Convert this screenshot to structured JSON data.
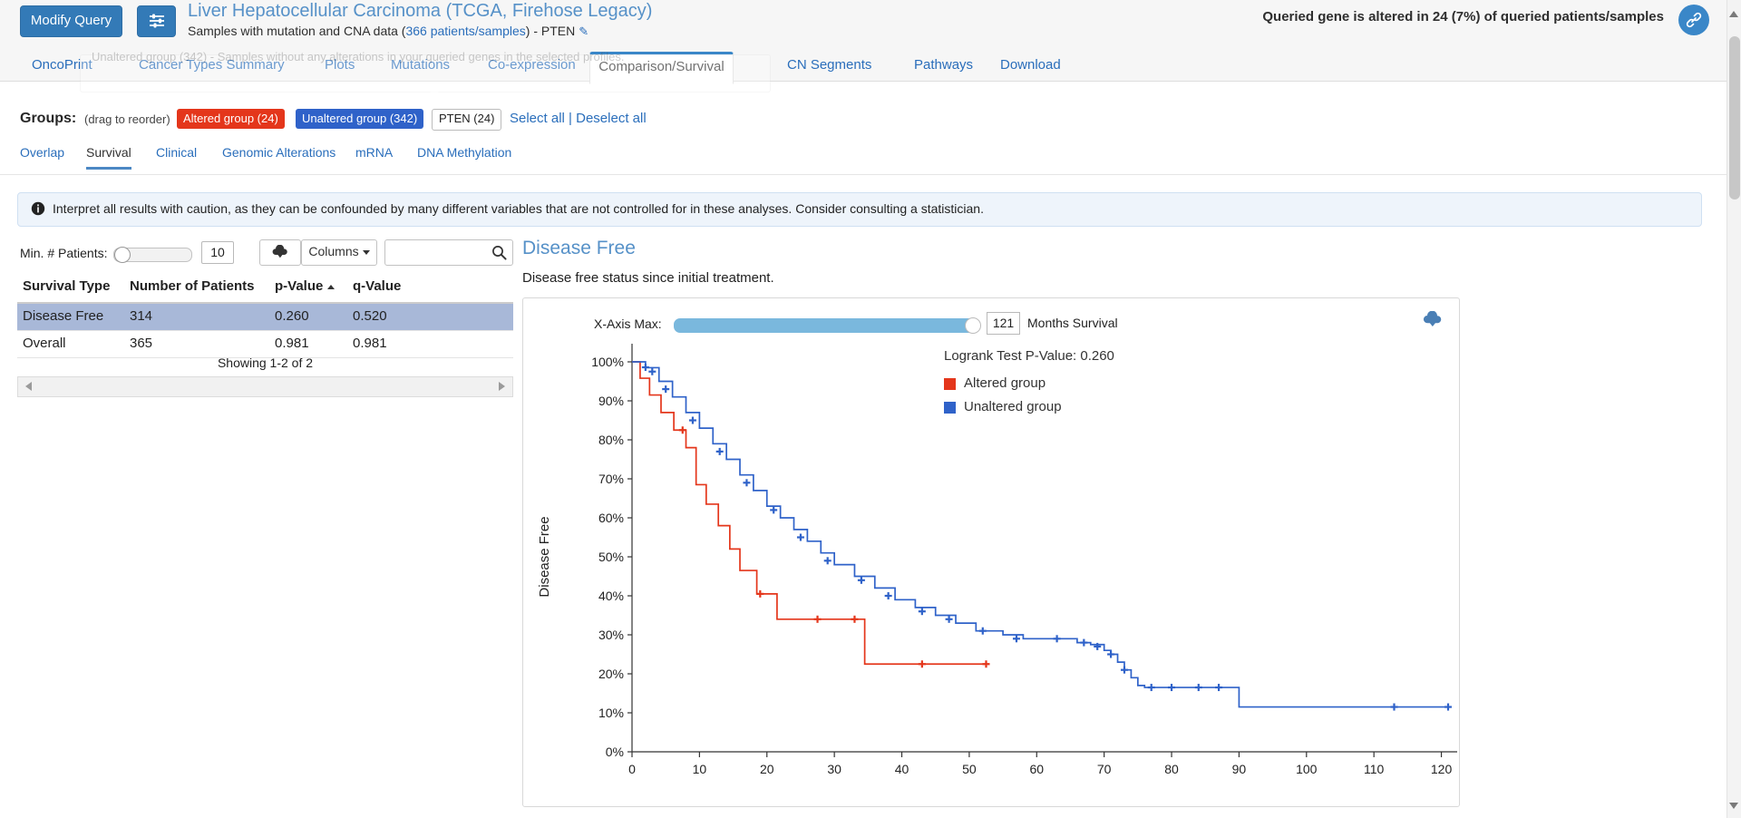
{
  "header": {
    "modify_query_label": "Modify Query",
    "settings_icon": "sliders-icon",
    "study_title": "Liver Hepatocellular Carcinoma (TCGA, Firehose Legacy)",
    "study_subtitle_prefix": "Samples with mutation and CNA data (",
    "study_sample_count": "366 patients/samples",
    "study_subtitle_suffix": ")  - PTEN",
    "edit_icon": "pencil-icon",
    "altered_note": "Queried gene is altered in 24 (7%) of queried patients/samples",
    "share_icon": "chain-link-icon"
  },
  "main_tabs": [
    {
      "label": "OncoPrint",
      "active": false
    },
    {
      "label": "Cancer Types Summary",
      "active": false
    },
    {
      "label": "Plots",
      "active": false
    },
    {
      "label": "Mutations",
      "active": false
    },
    {
      "label": "Co-expression",
      "active": false
    },
    {
      "label": "Comparison/Survival",
      "active": true
    },
    {
      "label": "CN Segments",
      "active": false
    },
    {
      "label": "Pathways",
      "active": false
    },
    {
      "label": "Download",
      "active": false
    }
  ],
  "tooltip_ghost": "Unaltered group (342) - Samples without any alterations in your queried genes in the selected profiles.",
  "groups": {
    "label": "Groups:",
    "hint": "(drag to reorder)",
    "pills": [
      {
        "label": "Altered group (24)",
        "style": "red"
      },
      {
        "label": "Unaltered group (342)",
        "style": "blue"
      },
      {
        "label": "PTEN (24)",
        "style": "plain"
      }
    ],
    "select_all": "Select all",
    "separator": "|",
    "deselect_all": "Deselect all"
  },
  "sub_tabs": [
    {
      "label": "Overlap",
      "active": false
    },
    {
      "label": "Survival",
      "active": true
    },
    {
      "label": "Clinical",
      "active": false
    },
    {
      "label": "Genomic Alterations",
      "active": false
    },
    {
      "label": "mRNA",
      "active": false
    },
    {
      "label": "DNA Methylation",
      "active": false
    }
  ],
  "banner": {
    "icon": "info-icon",
    "text": "Interpret all results with caution, as they can be confounded by many different variables that are not controlled for in these analyses. Consider consulting a statistician."
  },
  "toolbar": {
    "min_patients_label": "Min. # Patients:",
    "min_patients_value": "10",
    "download_icon": "cloud-download-icon",
    "columns_label": "Columns",
    "columns_caret": "chevron-down-icon",
    "search_placeholder": "",
    "search_value": "",
    "search_icon": "magnifier-icon"
  },
  "table": {
    "columns": [
      "Survival Type",
      "Number of Patients",
      "p-Value",
      "q-Value"
    ],
    "sorted_column": "p-Value",
    "sort_direction": "asc",
    "rows": [
      {
        "survival_type": "Disease Free",
        "patients": "314",
        "p_value": "0.260",
        "q_value": "0.520",
        "selected": true
      },
      {
        "survival_type": "Overall",
        "patients": "365",
        "p_value": "0.981",
        "q_value": "0.981",
        "selected": false
      }
    ],
    "showing": "Showing 1-2 of 2"
  },
  "panel": {
    "title": "Disease Free",
    "subtitle": "Disease free status since initial treatment.",
    "x_axis_max_label": "X-Axis Max:",
    "x_axis_max_value": "121",
    "x_axis_unit": "Months Survival",
    "chart_download_icon": "cloud-download-icon"
  },
  "chart_data": {
    "type": "line",
    "title": "Disease Free",
    "xlabel": "",
    "ylabel": "Disease Free",
    "xlim": [
      0,
      121
    ],
    "ylim": [
      0,
      100
    ],
    "grid": false,
    "legend_position": "right",
    "annotation": "Logrank Test P-Value: 0.260",
    "xticks": [
      0,
      10,
      20,
      30,
      40,
      50,
      60,
      70,
      80,
      90,
      100,
      110,
      120
    ],
    "yticks": [
      "0%",
      "10%",
      "20%",
      "30%",
      "40%",
      "50%",
      "60%",
      "70%",
      "80%",
      "90%",
      "100%"
    ],
    "colors": {
      "altered": "#e4361b",
      "unaltered": "#2f62c9"
    },
    "series": [
      {
        "name": "Altered group",
        "color": "#e4361b",
        "points": [
          [
            0,
            100
          ],
          [
            1.2,
            100
          ],
          [
            1.2,
            95.8
          ],
          [
            2.6,
            95.8
          ],
          [
            2.6,
            91.5
          ],
          [
            4.3,
            91.5
          ],
          [
            4.3,
            87.0
          ],
          [
            6.2,
            87.0
          ],
          [
            6.2,
            82.5
          ],
          [
            8.0,
            82.5
          ],
          [
            8.0,
            78.0
          ],
          [
            9.5,
            78.0
          ],
          [
            9.5,
            68.5
          ],
          [
            11.0,
            68.5
          ],
          [
            11.0,
            63.5
          ],
          [
            12.8,
            63.5
          ],
          [
            12.8,
            58.0
          ],
          [
            14.5,
            58.0
          ],
          [
            14.5,
            52.0
          ],
          [
            16.0,
            52.0
          ],
          [
            16.0,
            46.5
          ],
          [
            18.5,
            46.5
          ],
          [
            18.5,
            40.5
          ],
          [
            21.5,
            40.5
          ],
          [
            21.5,
            34.0
          ],
          [
            25.0,
            34.0
          ],
          [
            25.0,
            34.0
          ],
          [
            30.0,
            34.0
          ],
          [
            30.0,
            34.0
          ],
          [
            34.5,
            34.0
          ],
          [
            34.5,
            22.5
          ],
          [
            43.0,
            22.5
          ],
          [
            53.0,
            22.5
          ]
        ],
        "censor_marks": [
          [
            19.0,
            40.5
          ],
          [
            27.5,
            34.0
          ],
          [
            33.0,
            34.0
          ],
          [
            43.0,
            22.5
          ],
          [
            52.5,
            22.5
          ],
          [
            7.5,
            82.5
          ]
        ]
      },
      {
        "name": "Unaltered group",
        "color": "#2f62c9",
        "points": [
          [
            0,
            100
          ],
          [
            2,
            98.5
          ],
          [
            4,
            95
          ],
          [
            6,
            91
          ],
          [
            8,
            87
          ],
          [
            10,
            83
          ],
          [
            12,
            79
          ],
          [
            14,
            75
          ],
          [
            16,
            71
          ],
          [
            18,
            67
          ],
          [
            20,
            63
          ],
          [
            22,
            60
          ],
          [
            24,
            57
          ],
          [
            26,
            54
          ],
          [
            28,
            51
          ],
          [
            30,
            48
          ],
          [
            33,
            45
          ],
          [
            36,
            42
          ],
          [
            39,
            39
          ],
          [
            42,
            37
          ],
          [
            45,
            35
          ],
          [
            48,
            33
          ],
          [
            51,
            31
          ],
          [
            55,
            30
          ],
          [
            58,
            29
          ],
          [
            62,
            29
          ],
          [
            66,
            28
          ],
          [
            68,
            27.5
          ],
          [
            70,
            26
          ],
          [
            71,
            25
          ],
          [
            72,
            23
          ],
          [
            73,
            21
          ],
          [
            74,
            19
          ],
          [
            75,
            17
          ],
          [
            76,
            16.5
          ],
          [
            82,
            16.5
          ],
          [
            90,
            16.5
          ],
          [
            90,
            11.5
          ],
          [
            113,
            11.5
          ],
          [
            121,
            11.5
          ]
        ],
        "censor_marks": [
          [
            2,
            98.6
          ],
          [
            3,
            97.5
          ],
          [
            5,
            93
          ],
          [
            9,
            85
          ],
          [
            13,
            77
          ],
          [
            17,
            69
          ],
          [
            21,
            62
          ],
          [
            25,
            55
          ],
          [
            29,
            49
          ],
          [
            34,
            44
          ],
          [
            38,
            40
          ],
          [
            43,
            36
          ],
          [
            47,
            34
          ],
          [
            52,
            31
          ],
          [
            57,
            29
          ],
          [
            63,
            29
          ],
          [
            67,
            28
          ],
          [
            69,
            27
          ],
          [
            71,
            25
          ],
          [
            73,
            21
          ],
          [
            77,
            16.5
          ],
          [
            80,
            16.5
          ],
          [
            84,
            16.5
          ],
          [
            87,
            16.5
          ],
          [
            113,
            11.5
          ],
          [
            121,
            11.5
          ]
        ]
      }
    ],
    "legend": [
      {
        "label": "Altered group",
        "color": "#e4361b"
      },
      {
        "label": "Unaltered group",
        "color": "#2f62c9"
      }
    ]
  }
}
